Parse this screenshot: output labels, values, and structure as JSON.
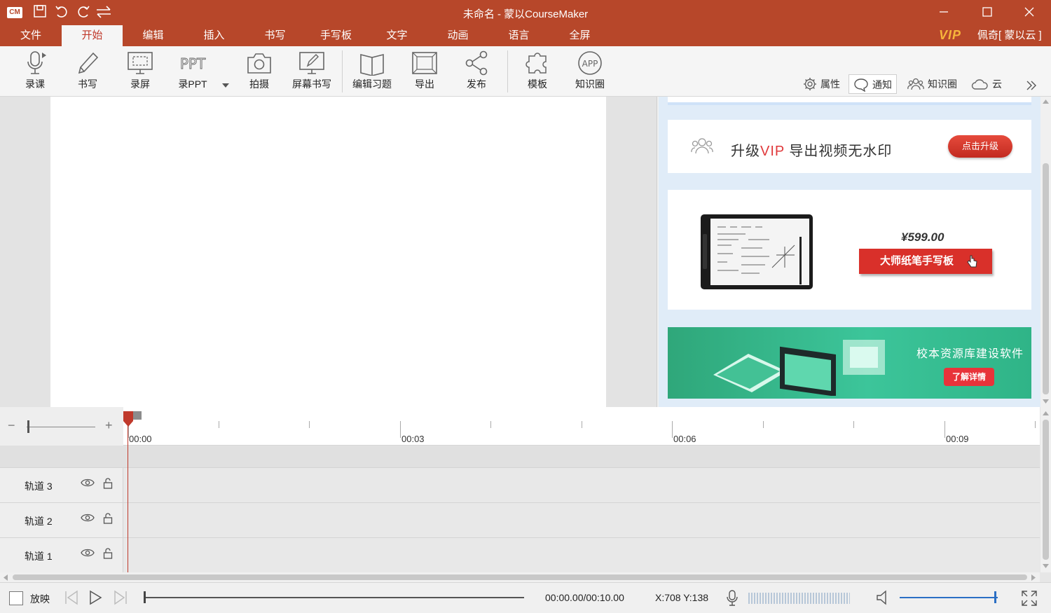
{
  "titlebar": {
    "logo": "CM",
    "title": "未命名 - 蒙以CourseMaker",
    "accent": "#b7472a"
  },
  "menu": {
    "tabs": [
      "文件",
      "开始",
      "编辑",
      "插入",
      "书写",
      "手写板",
      "文字",
      "动画",
      "语言",
      "全屏"
    ],
    "active": "开始",
    "vip": "VIP",
    "user": "佩奇[ 蒙以云 ]"
  },
  "ribbon": {
    "buttons": [
      "录课",
      "书写",
      "录屏",
      "录PPT",
      "拍摄",
      "屏幕书写",
      "编辑习题",
      "导出",
      "发布",
      "模板",
      "知识圈"
    ],
    "ppt_icon_text": "PPT",
    "app_icon_text": "APP",
    "tools": [
      "属性",
      "通知",
      "知识圈",
      "云"
    ],
    "active_tool": "通知"
  },
  "panel": {
    "vip_promo": {
      "prefix": "升级",
      "highlight": "VIP",
      "suffix": " 导出视频无水印",
      "button": "点击升级"
    },
    "product": {
      "price": "¥599.00",
      "button": "大师纸笔手写板"
    },
    "banner": {
      "title": "校本资源库建设软件",
      "button": "了解详情"
    }
  },
  "timeline": {
    "time_labels": [
      "00:00",
      "00:03",
      "00:06",
      "00:09"
    ],
    "tracks": [
      {
        "name": "轨道 3"
      },
      {
        "name": "轨道 2"
      },
      {
        "name": "轨道 1"
      }
    ],
    "zoom_minus": "−",
    "zoom_plus": "+"
  },
  "statusbar": {
    "play_label": "放映",
    "time": "00:00.00/00:10.00",
    "coords": "X:708 Y:138"
  }
}
